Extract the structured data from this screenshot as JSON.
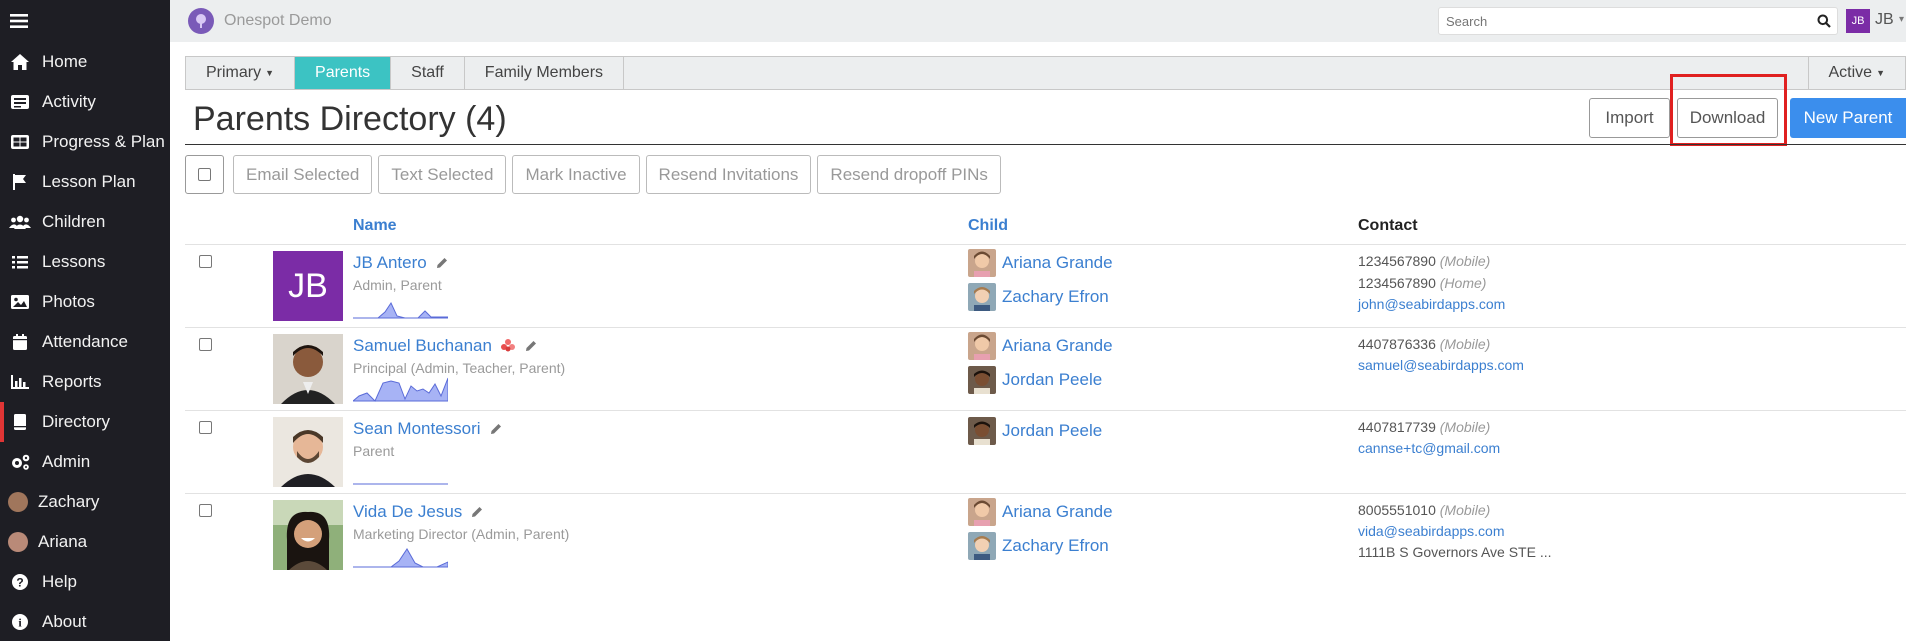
{
  "app": {
    "title": "Onespot Demo"
  },
  "topbar": {
    "search_placeholder": "Search",
    "user_initials": "JB",
    "user_name": "JB"
  },
  "sidebar": {
    "items": [
      {
        "label": "Home",
        "icon": "home-icon"
      },
      {
        "label": "Activity",
        "icon": "activity-icon"
      },
      {
        "label": "Progress & Plan",
        "icon": "progress-icon"
      },
      {
        "label": "Lesson Plan",
        "icon": "flag-icon"
      },
      {
        "label": "Children",
        "icon": "users-icon"
      },
      {
        "label": "Lessons",
        "icon": "list-icon"
      },
      {
        "label": "Photos",
        "icon": "image-icon"
      },
      {
        "label": "Attendance",
        "icon": "calendar-icon"
      },
      {
        "label": "Reports",
        "icon": "bar-chart-icon"
      },
      {
        "label": "Directory",
        "icon": "book-icon",
        "active": true
      },
      {
        "label": "Admin",
        "icon": "cogs-icon"
      },
      {
        "label": "Zachary",
        "icon": "avatar"
      },
      {
        "label": "Ariana",
        "icon": "avatar"
      },
      {
        "label": "Help",
        "icon": "question-icon"
      },
      {
        "label": "About",
        "icon": "info-icon"
      }
    ]
  },
  "tabs": {
    "primary": "Primary",
    "parents": "Parents",
    "staff": "Staff",
    "family": "Family Members",
    "status": "Active"
  },
  "page": {
    "title": "Parents Directory (4)",
    "import": "Import",
    "download": "Download",
    "new_parent": "New Parent"
  },
  "actions": {
    "email": "Email Selected",
    "text": "Text Selected",
    "inactive": "Mark Inactive",
    "resend_inv": "Resend Invitations",
    "resend_pins": "Resend dropoff PINs"
  },
  "table": {
    "col_name": "Name",
    "col_child": "Child",
    "col_contact": "Contact"
  },
  "rows": [
    {
      "initials": "JB",
      "name": "JB Antero",
      "role": "Admin, Parent",
      "children": [
        "Ariana Grande",
        "Zachary Efron"
      ],
      "phone1": "1234567890",
      "phone1_type": "(Mobile)",
      "phone2": "1234567890",
      "phone2_type": "(Home)",
      "email": "john@seabirdapps.com"
    },
    {
      "name": "Samuel Buchanan",
      "role": "Principal (Admin, Teacher, Parent)",
      "children": [
        "Ariana Grande",
        "Jordan Peele"
      ],
      "phone1": "4407876336",
      "phone1_type": "(Mobile)",
      "email": "samuel@seabirdapps.com"
    },
    {
      "name": "Sean Montessori",
      "role": "Parent",
      "children": [
        "Jordan Peele"
      ],
      "phone1": "4407817739",
      "phone1_type": "(Mobile)",
      "email": "cannse+tc@gmail.com"
    },
    {
      "name": "Vida De Jesus",
      "role": "Marketing Director (Admin, Parent)",
      "children": [
        "Ariana Grande",
        "Zachary Efron"
      ],
      "phone1": "8005551010",
      "phone1_type": "(Mobile)",
      "email": "vida@seabirdapps.com",
      "address": "1111B S Governors Ave STE ..."
    }
  ],
  "colors": {
    "sidebar_bg": "#1e1e24",
    "tab_selected": "#3cc3c3",
    "primary_button": "#3b8eed",
    "link": "#3b7fd0",
    "avatar_purple": "#7b2ca6",
    "highlight": "#e02020"
  }
}
